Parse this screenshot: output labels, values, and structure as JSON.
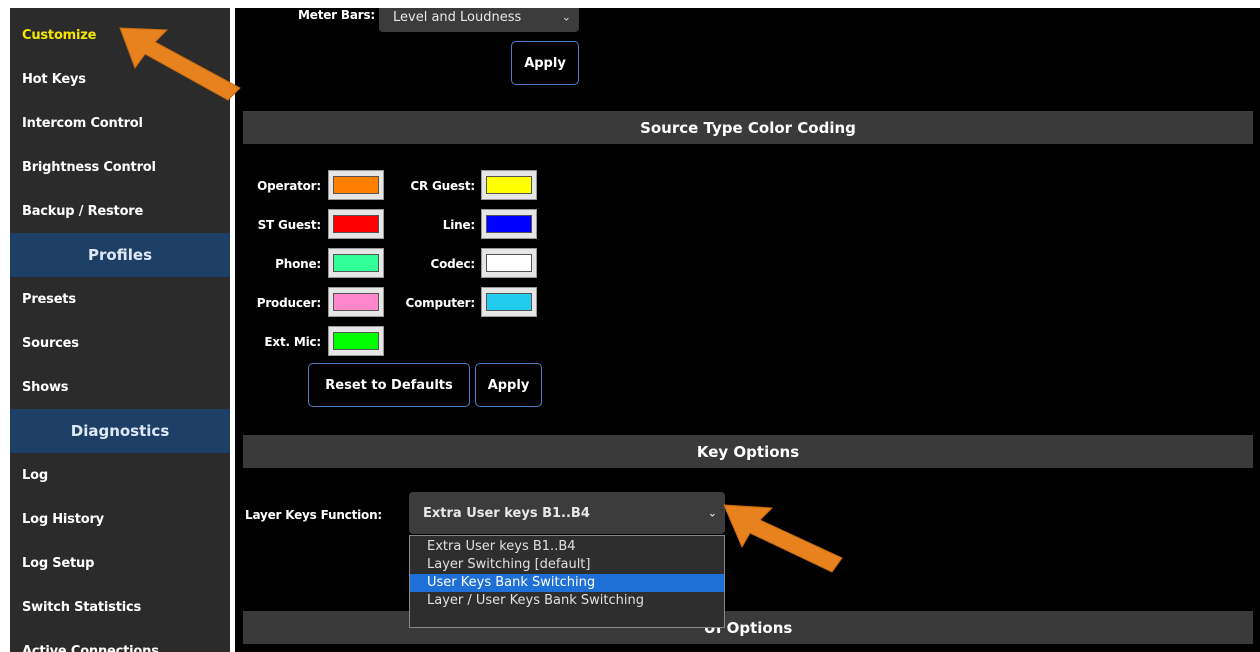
{
  "sidebar": {
    "items": [
      {
        "label": "Customize",
        "active": true
      },
      {
        "label": "Hot Keys"
      },
      {
        "label": "Intercom Control"
      },
      {
        "label": "Brightness Control"
      },
      {
        "label": "Backup / Restore"
      }
    ],
    "profiles_header": "Profiles",
    "profile_items": [
      {
        "label": "Presets"
      },
      {
        "label": "Sources"
      },
      {
        "label": "Shows"
      }
    ],
    "diagnostics_header": "Diagnostics",
    "diagnostic_items": [
      {
        "label": "Log"
      },
      {
        "label": "Log History"
      },
      {
        "label": "Log Setup"
      },
      {
        "label": "Switch Statistics"
      },
      {
        "label": "Active Connections"
      }
    ]
  },
  "meter": {
    "label": "Meter Bars:",
    "value": "Level and Loudness",
    "apply_label": "Apply"
  },
  "color_coding": {
    "title": "Source Type Color Coding",
    "items": [
      {
        "label": "Operator:",
        "color": "#ff8000"
      },
      {
        "label": "CR Guest:",
        "color": "#ffff00"
      },
      {
        "label": "ST Guest:",
        "color": "#ff0000"
      },
      {
        "label": "Line:",
        "color": "#0000ff"
      },
      {
        "label": "Phone:",
        "color": "#33ff99"
      },
      {
        "label": "Codec:",
        "color": "#ffffff"
      },
      {
        "label": "Producer:",
        "color": "#ff88cc"
      },
      {
        "label": "Computer:",
        "color": "#22ccee"
      },
      {
        "label": "Ext. Mic:",
        "color": "#00ff00"
      }
    ],
    "reset_label": "Reset to Defaults",
    "apply_label": "Apply"
  },
  "key_options": {
    "title": "Key Options",
    "layer_label": "Layer Keys Function:",
    "layer_value": "Extra User keys B1..B4",
    "options": [
      "Extra User keys B1..B4",
      "Layer Switching [default]",
      "User Keys Bank Switching",
      "Layer / User Keys Bank Switching"
    ],
    "highlighted_index": 2
  },
  "ui_options": {
    "title": "UI Options"
  },
  "colors": {
    "accent": "#e8821e",
    "sidebar_header": "#1d3f66",
    "button_border": "#4a7cc7",
    "active_text": "#f5e600"
  }
}
